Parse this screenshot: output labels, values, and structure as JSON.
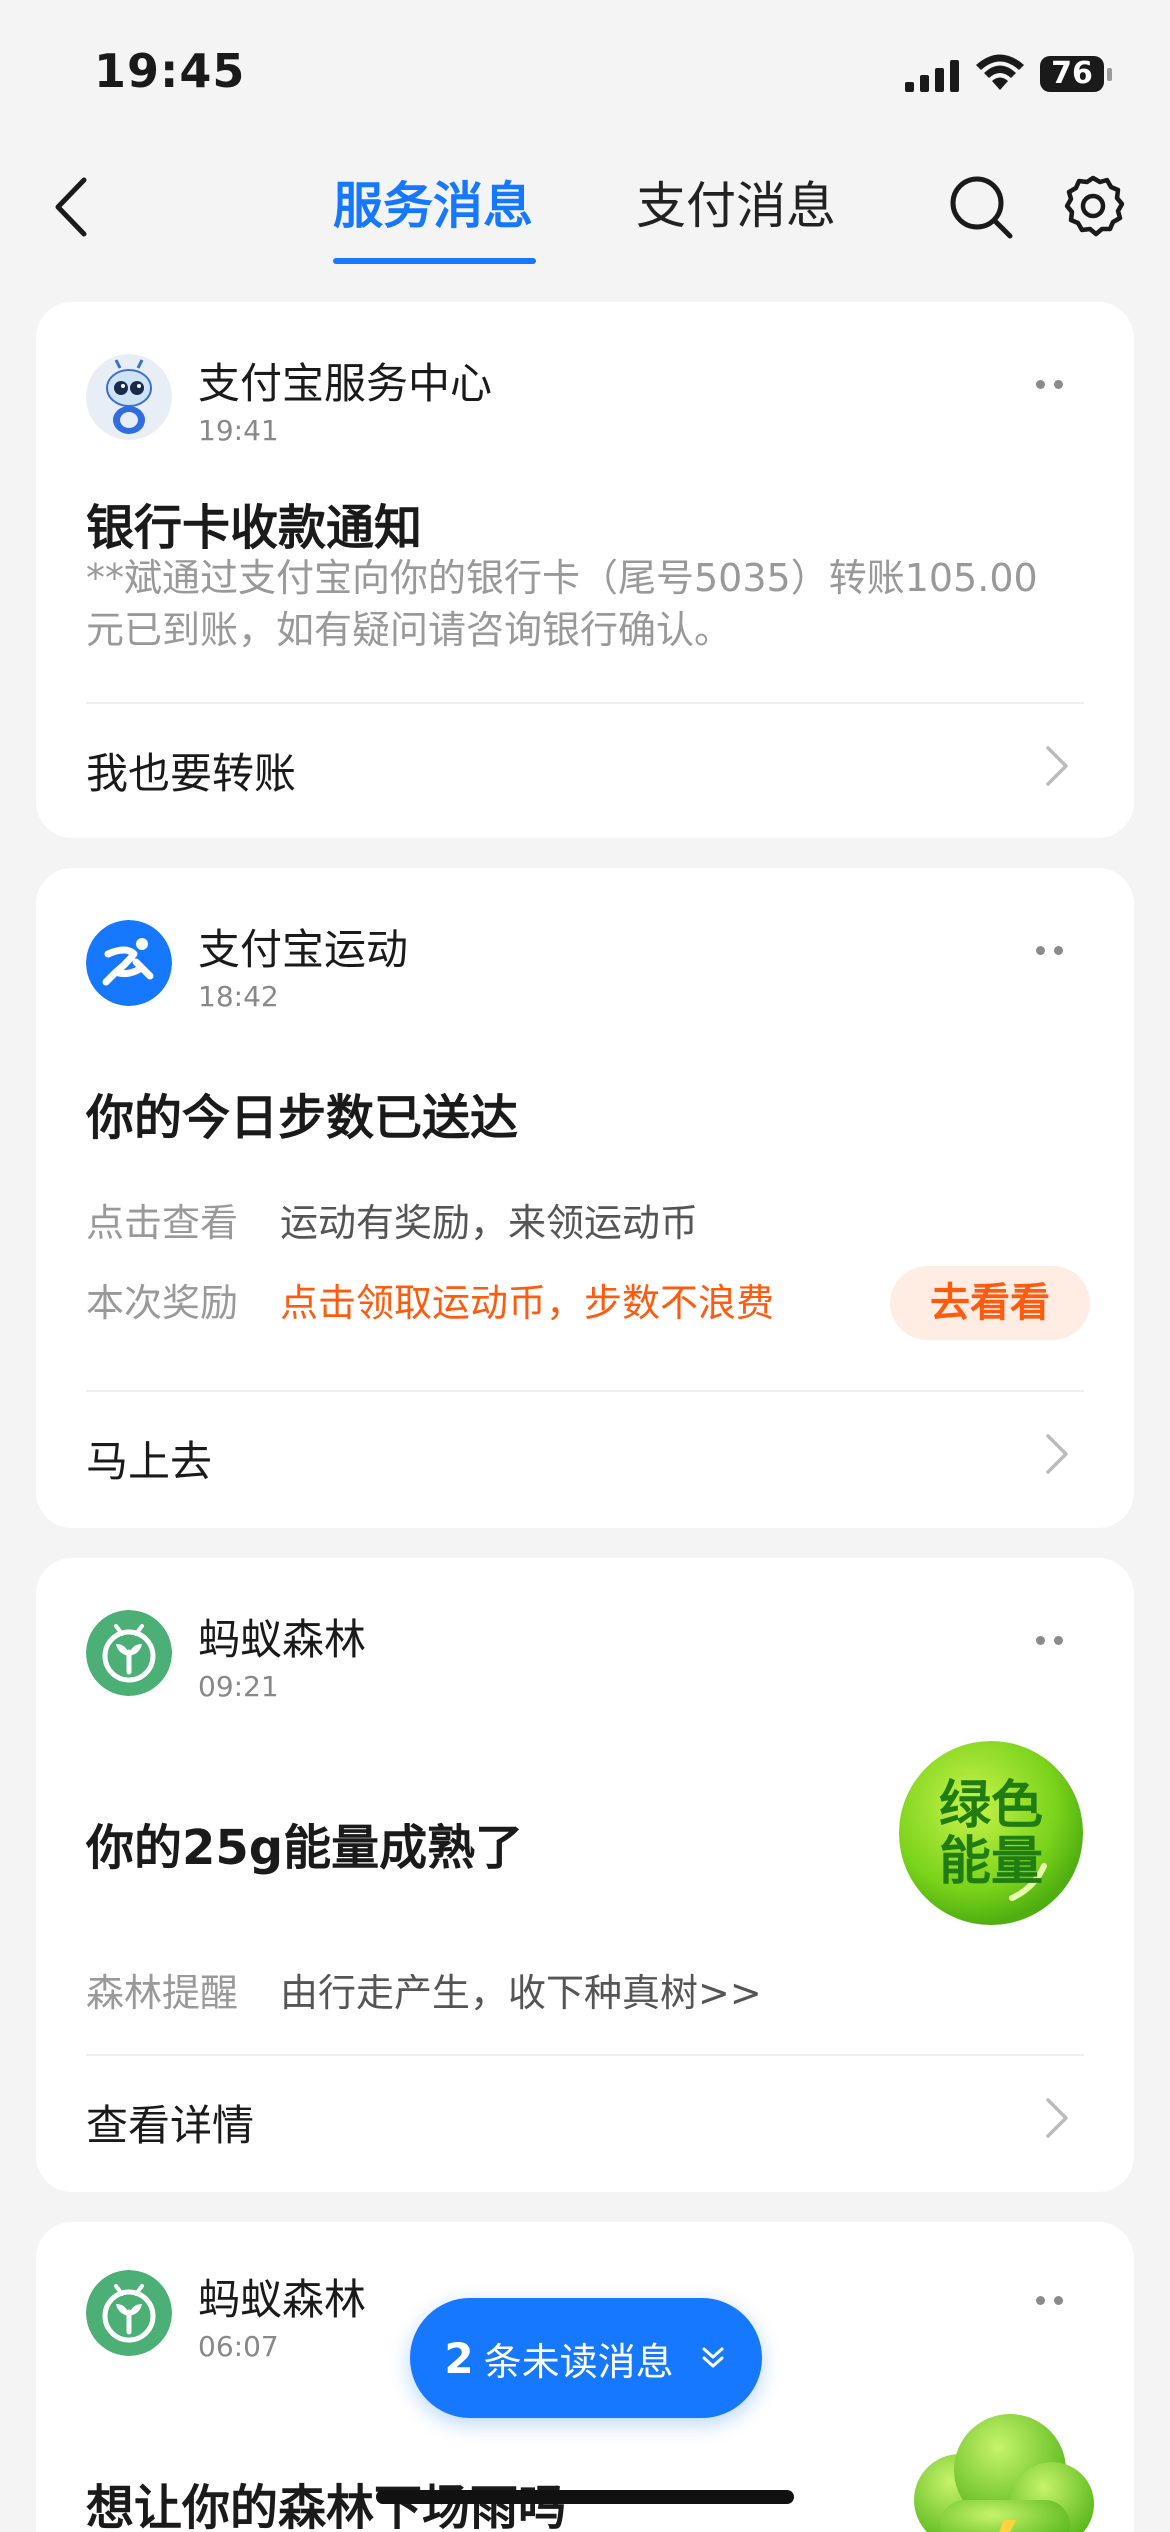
{
  "status_bar": {
    "time": "19:45",
    "battery": "76"
  },
  "nav": {
    "tabs": [
      {
        "label": "服务消息",
        "active": true
      },
      {
        "label": "支付消息",
        "active": false
      }
    ],
    "icons": {
      "back": "back-arrow-icon",
      "search": "search-icon",
      "settings": "gear-icon"
    }
  },
  "colors": {
    "accent": "#1677ff",
    "orange": "#ff5b0e",
    "forest_green": "#4caf75",
    "energy_green": "#7ad31a"
  },
  "cards": [
    {
      "sender": "支付宝服务中心",
      "time": "19:41",
      "title": "银行卡收款通知",
      "body": "**斌通过支付宝向你的银行卡（尾号5035）转账105.00元已到账，如有疑问请咨询银行确认。",
      "action": "我也要转账"
    },
    {
      "sender": "支付宝运动",
      "time": "18:42",
      "title": "你的今日步数已送达",
      "rows": [
        {
          "key": "点击查看",
          "value": "运动有奖励，来领运动币"
        },
        {
          "key": "本次奖励",
          "value": "点击领取运动币，步数不浪费"
        }
      ],
      "pill": "去看看",
      "action": "马上去"
    },
    {
      "sender": "蚂蚁森林",
      "time": "09:21",
      "title": "你的25g能量成熟了",
      "badge_line1": "绿色",
      "badge_line2": "能量",
      "rows": [
        {
          "key": "森林提醒",
          "value": "由行走产生，收下种真树>>"
        }
      ],
      "action": "查看详情"
    },
    {
      "sender": "蚂蚁森林",
      "time": "06:07",
      "title": "想让你的森林下场雨吗"
    }
  ],
  "unread": {
    "count": "2",
    "label": "条未读消息"
  }
}
